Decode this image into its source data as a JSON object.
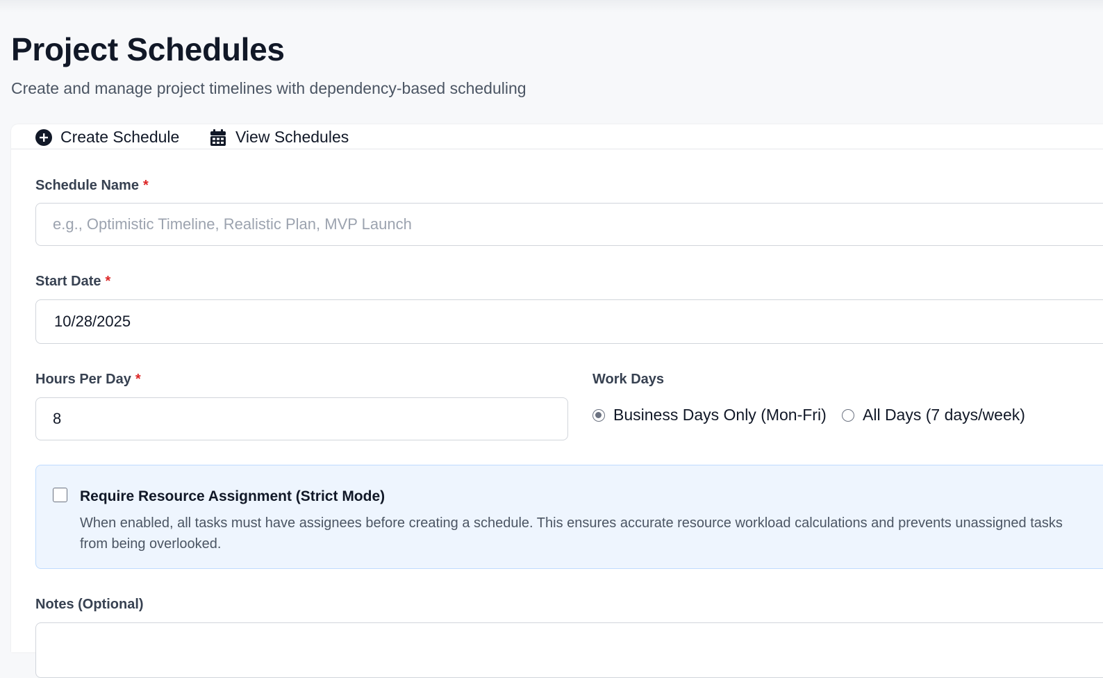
{
  "header": {
    "title": "Project Schedules",
    "subtitle": "Create and manage project timelines with dependency-based scheduling"
  },
  "tabs": [
    {
      "label": "Create Schedule",
      "icon": "plus-circle-icon"
    },
    {
      "label": "View Schedules",
      "icon": "calendar-icon"
    }
  ],
  "form": {
    "schedule_name": {
      "label": "Schedule Name",
      "required": "*",
      "value": "",
      "placeholder": "e.g., Optimistic Timeline, Realistic Plan, MVP Launch"
    },
    "start_date": {
      "label": "Start Date",
      "required": "*",
      "value": "10/28/2025"
    },
    "hours_per_day": {
      "label": "Hours Per Day",
      "required": "*",
      "value": "8"
    },
    "work_days": {
      "label": "Work Days",
      "options": [
        {
          "label": "Business Days Only (Mon-Fri)",
          "selected": true
        },
        {
          "label": "All Days (7 days/week)",
          "selected": false
        }
      ]
    },
    "strict_mode": {
      "label": "Require Resource Assignment (Strict Mode)",
      "checked": false,
      "description": "When enabled, all tasks must have assignees before creating a schedule. This ensures accurate resource workload calculations and prevents unassigned tasks from being overlooked."
    },
    "notes": {
      "label": "Notes (Optional)"
    }
  },
  "colors": {
    "accent_required": "#dc2626",
    "info_box_bg": "#eef5fe",
    "info_box_border": "#bfdbfe"
  }
}
